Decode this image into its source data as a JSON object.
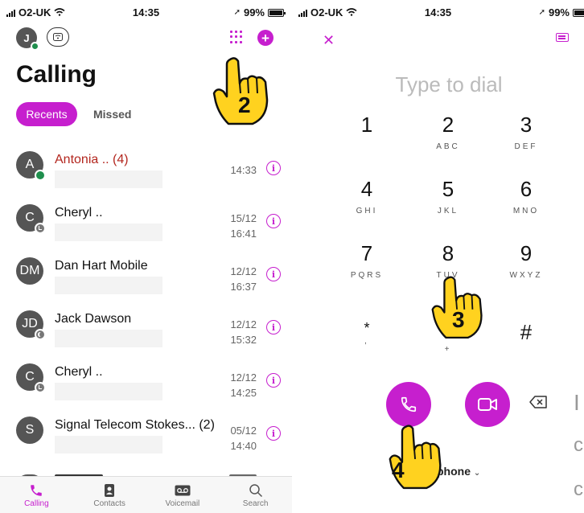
{
  "status_left": {
    "carrier": "O2-UK",
    "time": "14:35",
    "battery": "99%"
  },
  "status_right": {
    "carrier": "O2-UK",
    "time": "14:35",
    "battery": "99%"
  },
  "header": {
    "avatar_initial": "J",
    "title": "Calling"
  },
  "tabs": [
    {
      "label": "Recents",
      "active": true
    },
    {
      "label": "Missed",
      "active": false
    }
  ],
  "recents": [
    {
      "initials": "A",
      "name": "Antonia .. (4)",
      "missed": true,
      "date": "",
      "time": "14:33",
      "presence": "online"
    },
    {
      "initials": "C",
      "name": "Cheryl ..",
      "missed": false,
      "date": "15/12",
      "time": "16:41",
      "presence": "away"
    },
    {
      "initials": "DM",
      "name": "Dan Hart Mobile",
      "missed": false,
      "date": "12/12",
      "time": "16:37",
      "presence": "none"
    },
    {
      "initials": "JD",
      "name": "Jack Dawson",
      "missed": false,
      "date": "12/12",
      "time": "15:32",
      "presence": "dnd"
    },
    {
      "initials": "C",
      "name": "Cheryl ..",
      "missed": false,
      "date": "12/12",
      "time": "14:25",
      "presence": "away"
    },
    {
      "initials": "S",
      "name": "Signal Telecom Stokes... (2)",
      "missed": false,
      "date": "05/12",
      "time": "14:40",
      "presence": "none"
    }
  ],
  "bottom_tabs": [
    {
      "label": "Calling",
      "icon": "phone-icon",
      "selected": true
    },
    {
      "label": "Contacts",
      "icon": "contacts-icon",
      "selected": false
    },
    {
      "label": "Voicemail",
      "icon": "voicemail-icon",
      "selected": false
    },
    {
      "label": "Search",
      "icon": "search-icon",
      "selected": false
    }
  ],
  "dialer": {
    "placeholder": "Type to dial",
    "keys": [
      {
        "digit": "1",
        "letters": ""
      },
      {
        "digit": "2",
        "letters": "ABC"
      },
      {
        "digit": "3",
        "letters": "DEF"
      },
      {
        "digit": "4",
        "letters": "GHI"
      },
      {
        "digit": "5",
        "letters": "JKL"
      },
      {
        "digit": "6",
        "letters": "MNO"
      },
      {
        "digit": "7",
        "letters": "PQRS"
      },
      {
        "digit": "8",
        "letters": "TUV"
      },
      {
        "digit": "9",
        "letters": "WXYZ"
      },
      {
        "digit": "*",
        "letters": ","
      },
      {
        "digit": "0",
        "letters": "+"
      },
      {
        "digit": "#",
        "letters": ""
      }
    ],
    "device_label": "phone",
    "cutoff_text": [
      "I",
      "c",
      "c"
    ]
  },
  "callouts": [
    "2",
    "3",
    "4"
  ],
  "colors": {
    "accent": "#c61fce",
    "missed": "#b3261e",
    "online": "#1f8f4d"
  }
}
